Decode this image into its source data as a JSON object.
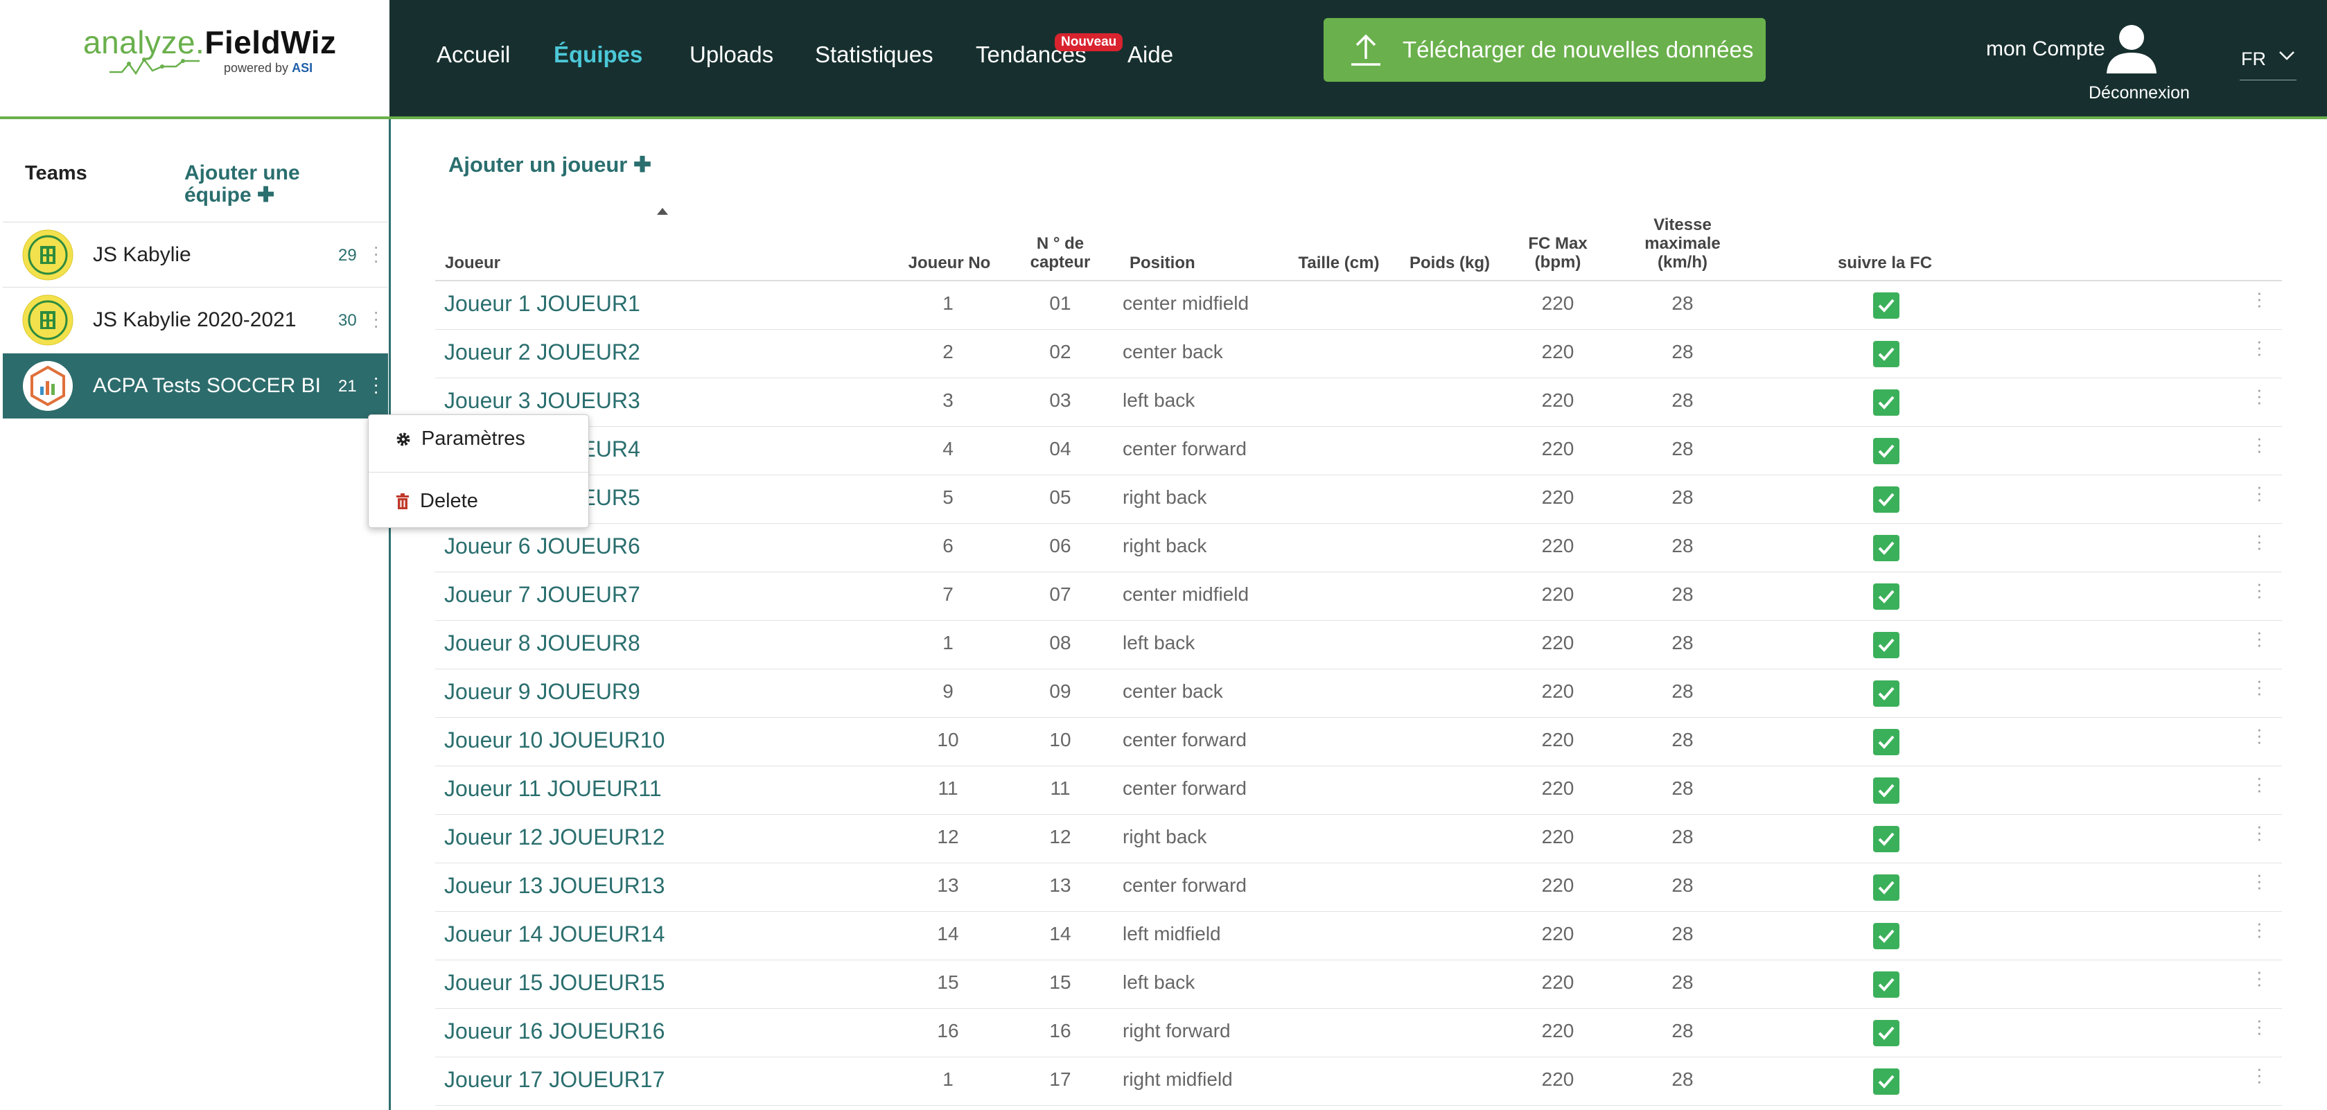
{
  "header": {
    "logo": {
      "part1": "analyze.",
      "part2": "FieldWiz",
      "powered_by": "powered by",
      "asi": "ASI"
    },
    "nav": [
      {
        "label": "Accueil",
        "active": false
      },
      {
        "label": "Équipes",
        "active": true
      },
      {
        "label": "Uploads",
        "active": false
      },
      {
        "label": "Statistiques",
        "active": false
      },
      {
        "label": "Tendances",
        "active": false
      },
      {
        "label": "Aide",
        "active": false
      }
    ],
    "badge": "Nouveau",
    "upload_label": "Télécharger de nouvelles données",
    "account_label": "mon Compte",
    "logout_label": "Déconnexion",
    "language": "FR"
  },
  "sidebar": {
    "title": "Teams",
    "add_team_label": "Ajouter une équipe",
    "teams": [
      {
        "name": "JS Kabylie",
        "count": "29",
        "logo": "jsk-crest",
        "selected": false
      },
      {
        "name": "JS Kabylie 2020-2021",
        "count": "30",
        "logo": "jsk-crest",
        "selected": false
      },
      {
        "name": "ACPA Tests SOCCER BI",
        "count": "21",
        "logo": "chart-logo",
        "selected": true
      }
    ],
    "context_menu": {
      "settings_label": "Paramètres",
      "delete_label": "Delete"
    }
  },
  "main": {
    "add_player_label": "Ajouter un joueur",
    "columns": {
      "player": "Joueur",
      "number": "Joueur No",
      "sensor_1": "N ° de",
      "sensor_2": "capteur",
      "position": "Position",
      "height": "Taille (cm)",
      "weight": "Poids (kg)",
      "hr_max_1": "FC Max",
      "hr_max_2": "(bpm)",
      "speed_1": "Vitesse",
      "speed_2": "maximale",
      "speed_3": "(km/h)",
      "track_hr": "suivre la FC"
    },
    "players": [
      {
        "name": "Joueur 1 JOUEUR1",
        "number": "1",
        "sensor": "01",
        "position": "center midfield",
        "height": "",
        "weight": "",
        "hr_max": "220",
        "max_speed": "28",
        "track_hr": true
      },
      {
        "name": "Joueur 2 JOUEUR2",
        "number": "2",
        "sensor": "02",
        "position": "center back",
        "height": "",
        "weight": "",
        "hr_max": "220",
        "max_speed": "28",
        "track_hr": true
      },
      {
        "name": "Joueur 3 JOUEUR3",
        "number": "3",
        "sensor": "03",
        "position": "left back",
        "height": "",
        "weight": "",
        "hr_max": "220",
        "max_speed": "28",
        "track_hr": true
      },
      {
        "name": "Joueur 4 JOUEUR4",
        "number": "4",
        "sensor": "04",
        "position": "center forward",
        "height": "",
        "weight": "",
        "hr_max": "220",
        "max_speed": "28",
        "track_hr": true
      },
      {
        "name": "Joueur 5 JOUEUR5",
        "number": "5",
        "sensor": "05",
        "position": "right back",
        "height": "",
        "weight": "",
        "hr_max": "220",
        "max_speed": "28",
        "track_hr": true
      },
      {
        "name": "Joueur 6 JOUEUR6",
        "number": "6",
        "sensor": "06",
        "position": "right back",
        "height": "",
        "weight": "",
        "hr_max": "220",
        "max_speed": "28",
        "track_hr": true
      },
      {
        "name": "Joueur 7 JOUEUR7",
        "number": "7",
        "sensor": "07",
        "position": "center midfield",
        "height": "",
        "weight": "",
        "hr_max": "220",
        "max_speed": "28",
        "track_hr": true
      },
      {
        "name": "Joueur 8 JOUEUR8",
        "number": "1",
        "sensor": "08",
        "position": "left back",
        "height": "",
        "weight": "",
        "hr_max": "220",
        "max_speed": "28",
        "track_hr": true
      },
      {
        "name": "Joueur 9 JOUEUR9",
        "number": "9",
        "sensor": "09",
        "position": "center back",
        "height": "",
        "weight": "",
        "hr_max": "220",
        "max_speed": "28",
        "track_hr": true
      },
      {
        "name": "Joueur 10 JOUEUR10",
        "number": "10",
        "sensor": "10",
        "position": "center forward",
        "height": "",
        "weight": "",
        "hr_max": "220",
        "max_speed": "28",
        "track_hr": true
      },
      {
        "name": "Joueur 11 JOUEUR11",
        "number": "11",
        "sensor": "11",
        "position": "center forward",
        "height": "",
        "weight": "",
        "hr_max": "220",
        "max_speed": "28",
        "track_hr": true
      },
      {
        "name": "Joueur 12 JOUEUR12",
        "number": "12",
        "sensor": "12",
        "position": "right back",
        "height": "",
        "weight": "",
        "hr_max": "220",
        "max_speed": "28",
        "track_hr": true
      },
      {
        "name": "Joueur 13 JOUEUR13",
        "number": "13",
        "sensor": "13",
        "position": "center forward",
        "height": "",
        "weight": "",
        "hr_max": "220",
        "max_speed": "28",
        "track_hr": true
      },
      {
        "name": "Joueur 14 JOUEUR14",
        "number": "14",
        "sensor": "14",
        "position": "left midfield",
        "height": "",
        "weight": "",
        "hr_max": "220",
        "max_speed": "28",
        "track_hr": true
      },
      {
        "name": "Joueur 15 JOUEUR15",
        "number": "15",
        "sensor": "15",
        "position": "left back",
        "height": "",
        "weight": "",
        "hr_max": "220",
        "max_speed": "28",
        "track_hr": true
      },
      {
        "name": "Joueur 16 JOUEUR16",
        "number": "16",
        "sensor": "16",
        "position": "right forward",
        "height": "",
        "weight": "",
        "hr_max": "220",
        "max_speed": "28",
        "track_hr": true
      },
      {
        "name": "Joueur 17 JOUEUR17",
        "number": "1",
        "sensor": "17",
        "position": "right midfield",
        "height": "",
        "weight": "",
        "hr_max": "220",
        "max_speed": "28",
        "track_hr": true
      }
    ]
  },
  "colors": {
    "header_bg": "#17302f",
    "accent_green": "#6ab04c",
    "teal": "#2a6e6e",
    "selected_row": "#2d6c6c",
    "checkbox": "#3bb05a",
    "badge_red": "#d9232e",
    "active_nav": "#4cc8d8"
  }
}
